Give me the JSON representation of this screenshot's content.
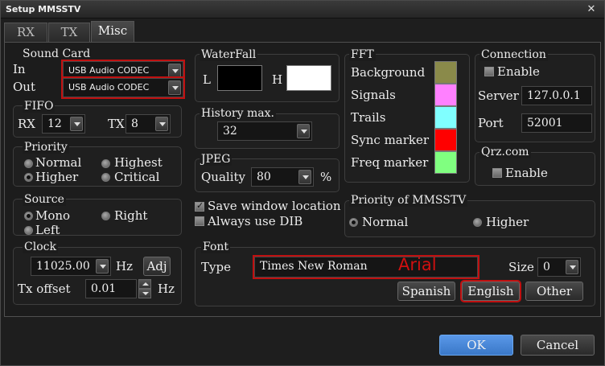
{
  "window": {
    "title": "Setup MMSSTV",
    "close_symbol": "✕"
  },
  "tabs": [
    {
      "label": "RX",
      "active": false
    },
    {
      "label": "TX",
      "active": false
    },
    {
      "label": "Misc",
      "active": true
    }
  ],
  "sound_card": {
    "title": "Sound Card",
    "in_label": "In",
    "in_value": "USB Audio CODEC",
    "out_label": "Out",
    "out_value": "USB Audio CODEC"
  },
  "fifo": {
    "title": "FIFO",
    "rx_label": "RX",
    "rx_value": "12",
    "tx_label": "TX",
    "tx_value": "8"
  },
  "priority": {
    "title": "Priority",
    "options": [
      "Normal",
      "Highest",
      "Higher",
      "Critical"
    ],
    "selected": "Higher"
  },
  "source": {
    "title": "Source",
    "options": [
      "Mono",
      "Right",
      "Left"
    ],
    "selected": "Mono"
  },
  "clock": {
    "title": "Clock",
    "value": "11025.00",
    "unit": "Hz",
    "adj_label": "Adj",
    "tx_offset_label": "Tx offset",
    "tx_offset_value": "0.01",
    "tx_offset_unit": "Hz"
  },
  "waterfall": {
    "title": "WaterFall",
    "l_label": "L",
    "h_label": "H",
    "l_color": "#000000",
    "h_color": "#ffffff"
  },
  "history": {
    "title": "History max.",
    "value": "32"
  },
  "jpeg": {
    "title": "JPEG",
    "quality_label": "Quality",
    "quality_value": "80",
    "unit": "%"
  },
  "options": {
    "save_window_location": "Save window location",
    "save_checked": true,
    "always_use_dib": "Always use DIB",
    "dib_checked": false
  },
  "fft": {
    "title": "FFT",
    "items": [
      {
        "label": "Background",
        "color": "#8a8a4a"
      },
      {
        "label": "Signals",
        "color": "#ff80ff"
      },
      {
        "label": "Trails",
        "color": "#80ffff"
      },
      {
        "label": "Sync marker",
        "color": "#ff0000"
      },
      {
        "label": "Freq marker",
        "color": "#80ff80"
      }
    ]
  },
  "connection": {
    "title": "Connection",
    "enable_label": "Enable",
    "enable_checked": false,
    "server_label": "Server",
    "server_value": "127.0.0.1",
    "port_label": "Port",
    "port_value": "52001"
  },
  "qrz": {
    "title": "Qrz.com",
    "enable_label": "Enable",
    "enable_checked": false
  },
  "mmsstv_priority": {
    "title": "Priority of MMSSTV",
    "options": [
      "Normal",
      "Higher"
    ],
    "selected": "Normal"
  },
  "font": {
    "title": "Font",
    "type_label": "Type",
    "type_value": "Times New Roman",
    "annotation": "Arial",
    "size_label": "Size",
    "size_value": "0",
    "buttons": [
      "Spanish",
      "English",
      "Other"
    ]
  },
  "footer": {
    "ok_label": "OK",
    "cancel_label": "Cancel"
  },
  "colors": {
    "accent_red": "#c01010",
    "ok_blue": "#3a78c8"
  }
}
